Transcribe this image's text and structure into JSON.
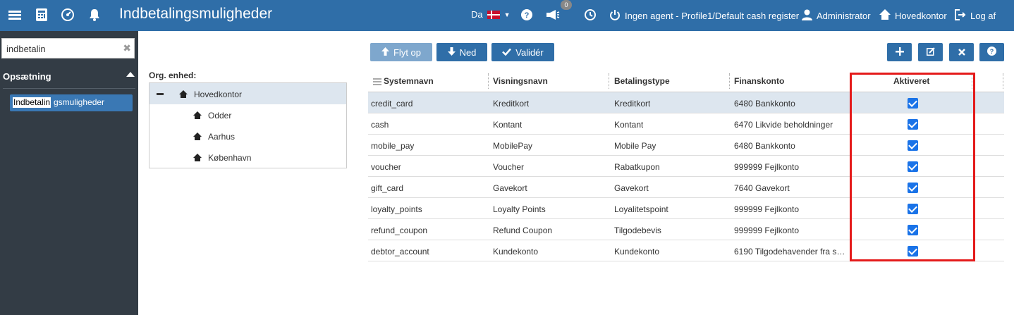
{
  "header": {
    "title": "Indbetalingsmuligheder",
    "language": "Da",
    "notification_count": "0",
    "agent_status": "Ingen agent - Profile1/Default cash register",
    "user": "Administrator",
    "store": "Hovedkontor",
    "logout": "Log af",
    "icons": [
      "menu-icon",
      "calculator-icon",
      "dashboard-icon",
      "bell-icon",
      "help-icon",
      "megaphone-icon",
      "clock-icon",
      "power-icon",
      "user-icon",
      "home-icon",
      "logout-icon"
    ]
  },
  "sidebar": {
    "search_value": "indbetalin",
    "section": "Opsætning",
    "items": [
      {
        "label_match": "Indbetalin",
        "label_rest": "gsmuligheder"
      }
    ]
  },
  "org": {
    "label": "Org. enhed:",
    "root": "Hovedkontor",
    "children": [
      "Odder",
      "Aarhus",
      "København"
    ]
  },
  "toolbar": {
    "move_up": "Flyt op",
    "down": "Ned",
    "validate": "Validér",
    "right_buttons": [
      "add-icon",
      "edit-icon",
      "delete-icon",
      "help-icon"
    ]
  },
  "grid": {
    "columns": [
      "Systemnavn",
      "Visningsnavn",
      "Betalingstype",
      "Finanskonto",
      "Aktiveret"
    ],
    "rows": [
      {
        "system": "credit_card",
        "display": "Kreditkort",
        "type": "Kreditkort",
        "account": "6480 Bankkonto",
        "active": true
      },
      {
        "system": "cash",
        "display": "Kontant",
        "type": "Kontant",
        "account": "6470 Likvide beholdninger",
        "active": true
      },
      {
        "system": "mobile_pay",
        "display": "MobilePay",
        "type": "Mobile Pay",
        "account": "6480 Bankkonto",
        "active": true
      },
      {
        "system": "voucher",
        "display": "Voucher",
        "type": "Rabatkupon",
        "account": "999999 Fejlkonto",
        "active": true
      },
      {
        "system": "gift_card",
        "display": "Gavekort",
        "type": "Gavekort",
        "account": "7640 Gavekort",
        "active": true
      },
      {
        "system": "loyalty_points",
        "display": "Loyalty Points",
        "type": "Loyalitetspoint",
        "account": "999999 Fejlkonto",
        "active": true
      },
      {
        "system": "refund_coupon",
        "display": "Refund Coupon",
        "type": "Tilgodebevis",
        "account": "999999 Fejlkonto",
        "active": true
      },
      {
        "system": "debtor_account",
        "display": "Kundekonto",
        "type": "Kundekonto",
        "account": "6190 Tilgodehavender fra s…",
        "active": true
      }
    ]
  },
  "colors": {
    "header": "#2f6ea8",
    "sidebar": "#333c45",
    "highlight": "#e41b1b"
  }
}
